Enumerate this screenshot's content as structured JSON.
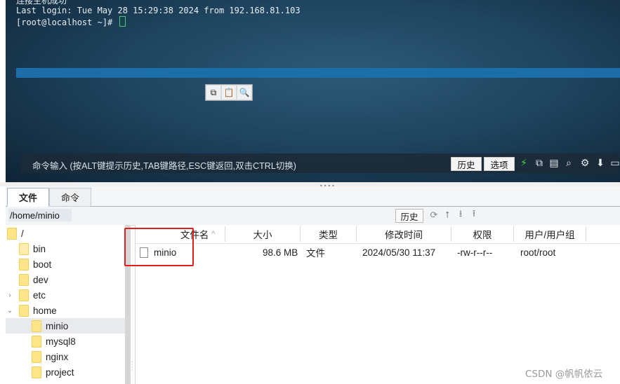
{
  "terminal": {
    "lines": [
      "连接主机成功",
      "Last login: Tue May 28 15:29:38 2024 from 192.168.81.103",
      "[root@localhost ~]# "
    ],
    "command_bar": {
      "hint": "命令输入 (按ALT键提示历史,TAB键路径,ESC键返回,双击CTRL切换)",
      "history_label": "历史",
      "options_label": "选项"
    }
  },
  "tabs": [
    {
      "label": "文件"
    },
    {
      "label": "命令"
    }
  ],
  "path_bar": {
    "path": "/home/minio",
    "history_label": "历史"
  },
  "tree": [
    {
      "label": "/",
      "selected": false
    },
    {
      "label": "bin"
    },
    {
      "label": "boot"
    },
    {
      "label": "dev"
    },
    {
      "label": "etc"
    },
    {
      "label": "home"
    },
    {
      "label": "minio",
      "selected": true
    },
    {
      "label": "mysql8"
    },
    {
      "label": "nginx"
    },
    {
      "label": "project"
    }
  ],
  "file_list": {
    "columns": [
      "文件名",
      "大小",
      "类型",
      "修改时间",
      "权限",
      "用户/用户组"
    ],
    "sort_indicator": "^",
    "rows": [
      {
        "name": "minio",
        "size": "98.6 MB",
        "type": "文件",
        "modified": "2024/05/30 11:37",
        "perms": "-rw-r--r--",
        "owner": "root/root"
      }
    ]
  },
  "colors": {
    "terminal_bg": "#1f4560",
    "highlight": "#e02020",
    "selected_row": "#e8eaed"
  },
  "watermark": "CSDN @帆帆依云"
}
